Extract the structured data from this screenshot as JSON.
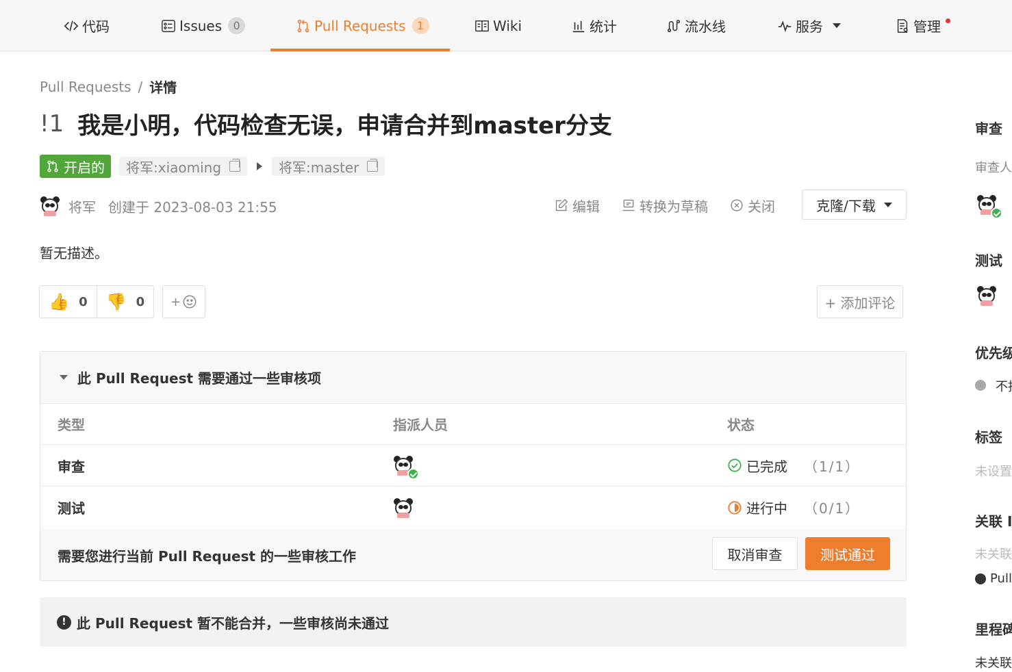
{
  "tabs": [
    {
      "label": "代码",
      "icon": "code-icon"
    },
    {
      "label": "Issues",
      "count": "0",
      "icon": "issues-icon"
    },
    {
      "label": "Pull Requests",
      "count": "1",
      "icon": "pull-request-icon"
    },
    {
      "label": "Wiki",
      "icon": "wiki-icon"
    },
    {
      "label": "统计",
      "icon": "stats-icon"
    },
    {
      "label": "流水线",
      "icon": "pipeline-icon"
    },
    {
      "label": "服务",
      "icon": "service-icon"
    },
    {
      "label": "管理",
      "icon": "manage-icon"
    }
  ],
  "colors": {
    "accent": "#ef7d2e",
    "open_green": "#52a73b",
    "done_green": "#3fb14d"
  },
  "breadcrumb": {
    "parent": "Pull Requests",
    "sep": "/",
    "current": "详情"
  },
  "pr": {
    "number": "!1",
    "title": "我是小明，代码检查无误，申请合并到master分支",
    "state": "开启的",
    "source_branch": "将军:xiaoming",
    "target_branch": "将军:master",
    "author": "将军",
    "created": "创建于 2023-08-03 21:55",
    "description": "暂无描述。"
  },
  "actions": {
    "edit": "编辑",
    "draft": "转换为草稿",
    "close": "关闭",
    "clone": "克隆/下载"
  },
  "reactions": {
    "up": "0",
    "down": "0",
    "emoji_plus": "+",
    "add_comment": "+ 添加评论"
  },
  "review": {
    "header": "此 Pull Request 需要通过一些审核项",
    "columns": [
      "类型",
      "指派人员",
      "状态"
    ],
    "rows": [
      {
        "type": "审查",
        "status": "已完成",
        "fraction": "（1/1）"
      },
      {
        "type": "测试",
        "status": "进行中",
        "fraction": "（0/1）"
      }
    ],
    "footer": "需要您进行当前 Pull Request 的一些审核工作",
    "cancel": "取消审查",
    "pass": "测试通过"
  },
  "merge_notice": "此 Pull Request 暂不能合并，一些审核尚未通过",
  "sidebar": {
    "review": "审查",
    "reviewer": "审查人",
    "test": "测试",
    "priority": "优先级",
    "priority_value": "不指定",
    "labels": "标签",
    "labels_value": "未设置",
    "linked_issues": "关联 Issues",
    "linked_value": "未关联",
    "linked_pull": "Pull Requests",
    "milestone": "里程碑",
    "milestone_value": "未关联"
  }
}
